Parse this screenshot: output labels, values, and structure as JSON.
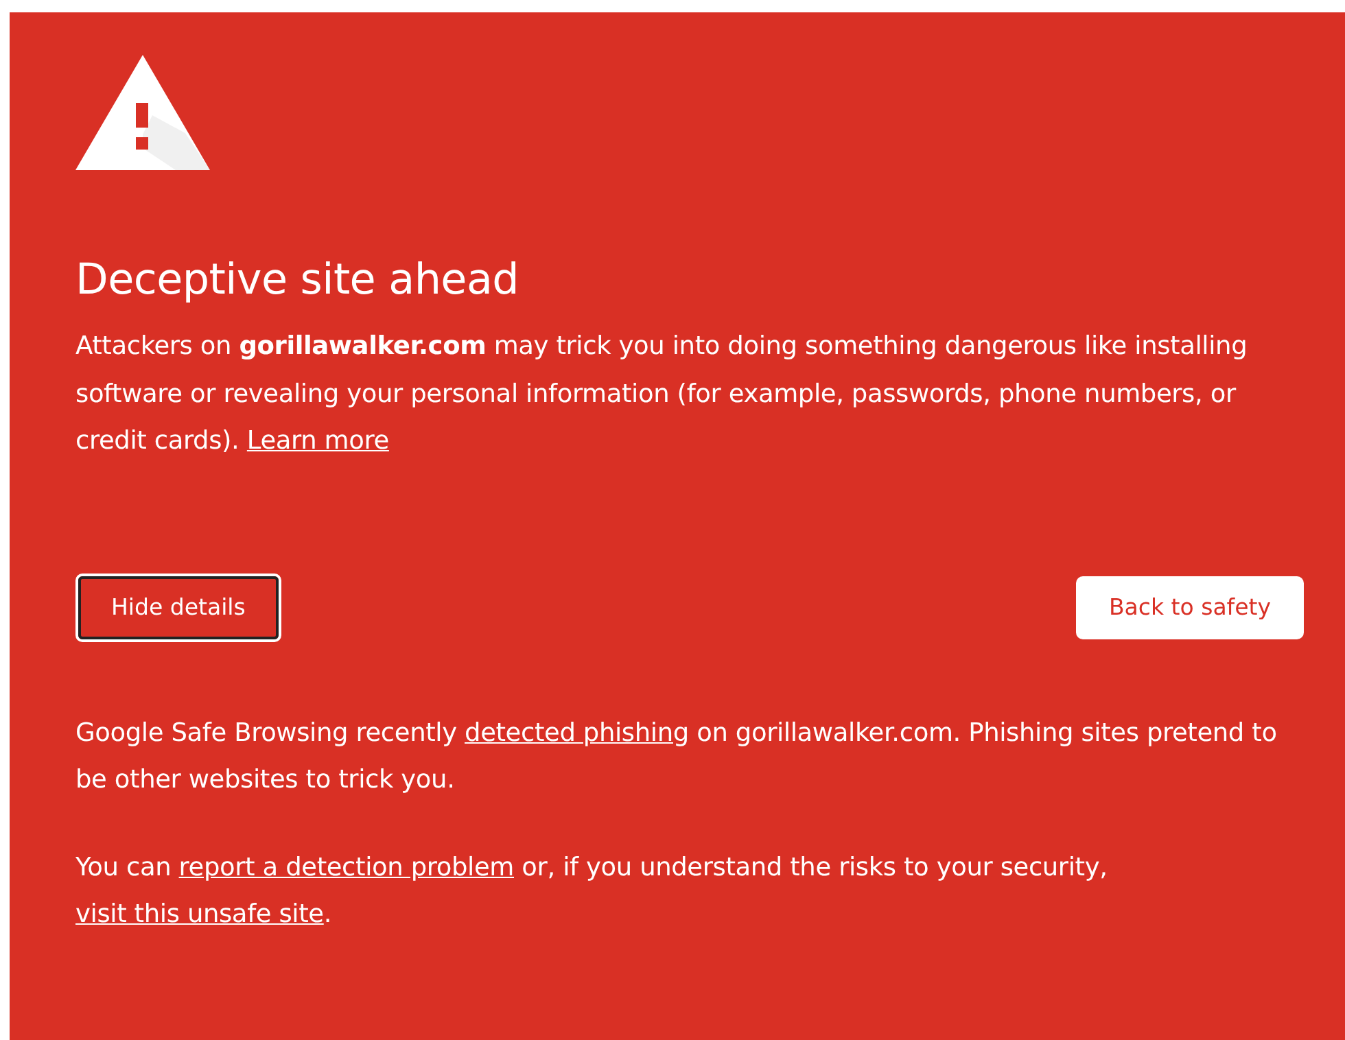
{
  "heading": "Deceptive site ahead",
  "intro": [
    {
      "kind": "text",
      "text": "Attackers on **gorillawalker.com** may trick you into doing something dangerous like installing software or revealing your personal information (for example, passwords, phone numbers, or credit cards). "
    },
    {
      "kind": "link",
      "text": "Learn more"
    }
  ],
  "buttons": {
    "details": "Hide details",
    "primary": "Back to safety"
  },
  "details": [
    [
      {
        "kind": "text",
        "text": "Google Safe Browsing recently "
      },
      {
        "kind": "link",
        "text": "detected phishing"
      },
      {
        "kind": "text",
        "text": " on gorillawalker.com. Phishing sites pretend to be other websites to trick you."
      }
    ],
    [
      {
        "kind": "text",
        "text": "You can "
      },
      {
        "kind": "link",
        "text": "report a detection problem"
      },
      {
        "kind": "text",
        "text": " or, if you understand the risks to your security, "
      },
      {
        "kind": "link",
        "text": "visit this unsafe site"
      },
      {
        "kind": "text",
        "text": "."
      }
    ]
  ]
}
